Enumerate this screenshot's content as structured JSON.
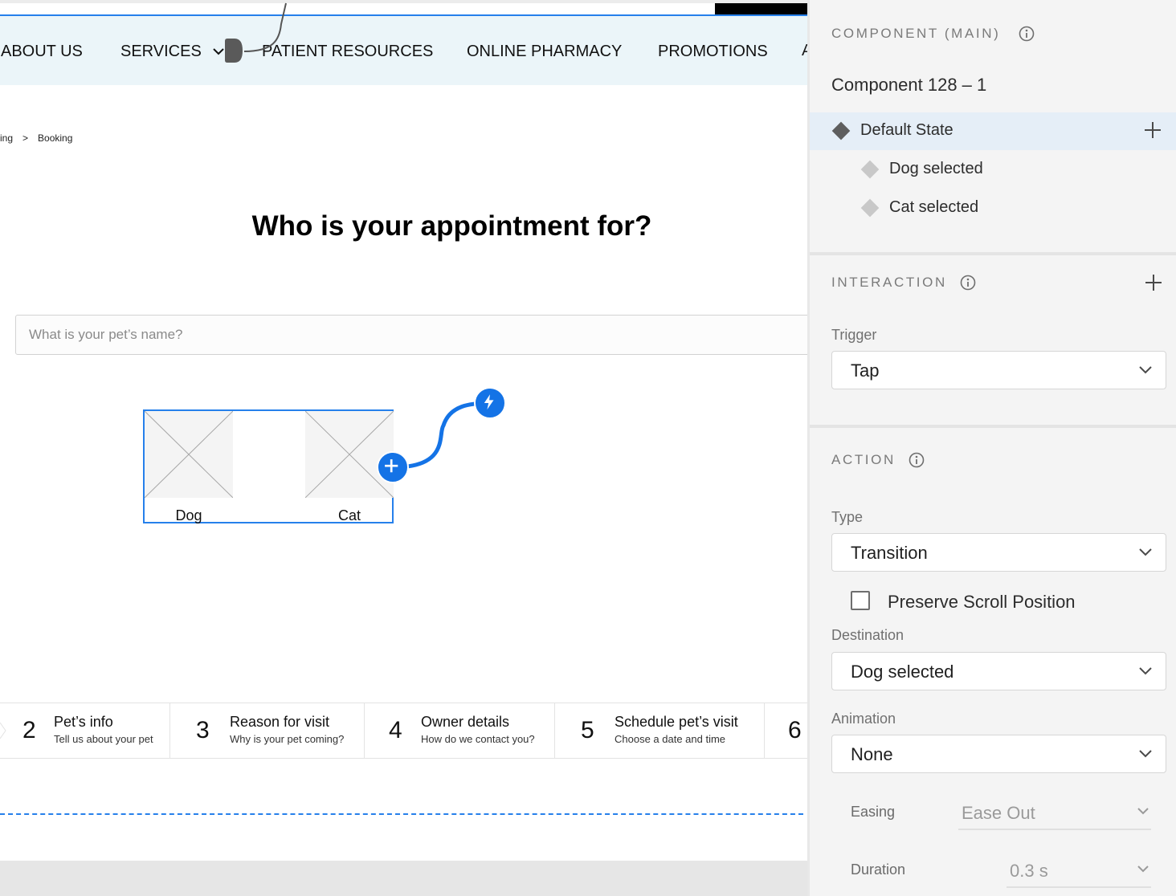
{
  "nav": {
    "items": [
      "ABOUT US",
      "SERVICES",
      "PATIENT RESOURCES",
      "ONLINE PHARMACY",
      "PROMOTIONS"
    ],
    "more": "A"
  },
  "breadcrumb": {
    "prev": "ing",
    "separator": ">",
    "current": "Booking"
  },
  "headline": "Who is your appointment for?",
  "pet_name_input": {
    "placeholder": "What is your pet’s name?",
    "value": ""
  },
  "pet_options": [
    {
      "label": "Dog",
      "icon": "image-placeholder-icon"
    },
    {
      "label": "Cat",
      "icon": "image-placeholder-icon"
    }
  ],
  "steps": [
    {
      "number": "2",
      "title": "Pet’s info",
      "subtitle": "Tell us about your pet"
    },
    {
      "number": "3",
      "title": "Reason for visit",
      "subtitle": "Why is your pet coming?"
    },
    {
      "number": "4",
      "title": "Owner details",
      "subtitle": "How do we contact you?"
    },
    {
      "number": "5",
      "title": "Schedule pet’s visit",
      "subtitle": "Choose a date and time"
    },
    {
      "number": "6",
      "title": "",
      "subtitle": ""
    }
  ],
  "inspector": {
    "component_section": {
      "title": "COMPONENT (MAIN)",
      "name": "Component 128 – 1",
      "states": [
        {
          "label": "Default State",
          "active": true
        },
        {
          "label": "Dog selected",
          "active": false
        },
        {
          "label": "Cat selected",
          "active": false
        }
      ]
    },
    "interaction_section": {
      "title": "INTERACTION",
      "trigger_label": "Trigger",
      "trigger_value": "Tap"
    },
    "action_section": {
      "title": "ACTION",
      "type_label": "Type",
      "type_value": "Transition",
      "preserve_scroll_label": "Preserve Scroll Position",
      "preserve_scroll_checked": false,
      "destination_label": "Destination",
      "destination_value": "Dog selected",
      "animation_label": "Animation",
      "animation_value": "None",
      "easing_label": "Easing",
      "easing_value": "Ease Out",
      "duration_label": "Duration",
      "duration_value": "0.3 s"
    }
  },
  "colors": {
    "accent": "#1473e6",
    "selection": "#2680eb",
    "nav_bg": "#ebf5f9",
    "panel_bg": "#f4f4f4",
    "active_row": "#e5eef7"
  }
}
